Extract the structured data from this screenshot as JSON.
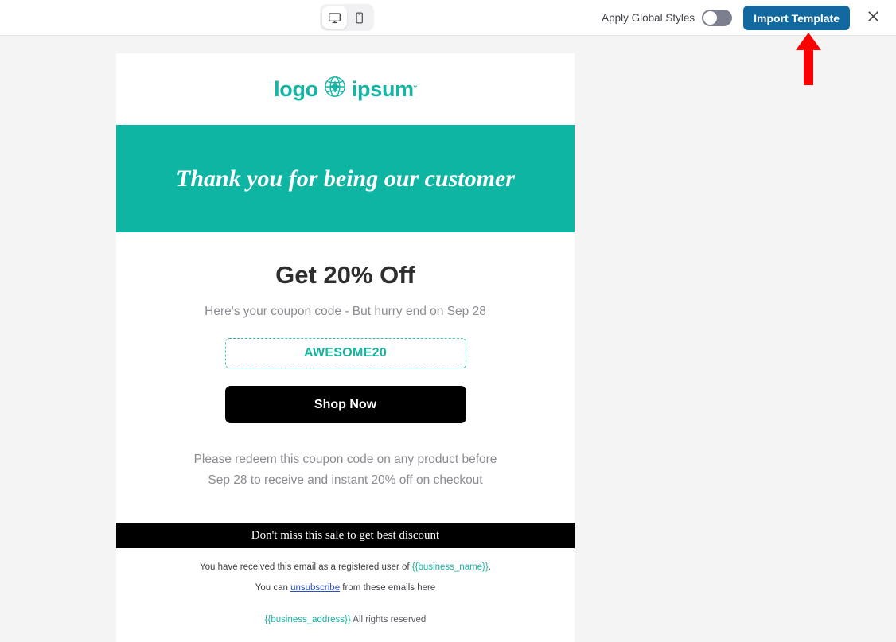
{
  "toolbar": {
    "device_switcher": {
      "options": [
        {
          "id": "desktop",
          "icon": "desktop-monitor-icon",
          "active": true
        },
        {
          "id": "mobile",
          "icon": "mobile-phone-icon",
          "active": false
        }
      ]
    },
    "apply_global_styles_label": "Apply Global Styles",
    "apply_global_styles_on": false,
    "import_template_label": "Import Template",
    "close_icon": "close-x-icon",
    "accent_blue": "#11699f"
  },
  "annotation": {
    "arrow_icon": "red-up-arrow-icon",
    "color": "#fa0000",
    "points_at": "Import Template"
  },
  "email": {
    "brand": {
      "word_one": "logo",
      "word_two": "ipsum",
      "trademark": "˘",
      "icon": "globe-compass-icon",
      "color": "#16b5a3"
    },
    "banner": {
      "text": "Thank you for being our customer",
      "background": "#0fb5a3",
      "text_color": "#ffffff"
    },
    "headline": "Get 20% Off",
    "subtitle": "Here's your coupon code - But hurry end on Sep 28",
    "coupon_code": "AWESOME20",
    "coupon_color": "#17b3a1",
    "cta_label": "Shop Now",
    "cta_background": "#000000",
    "redeem_line_1": "Please redeem this coupon code on any product before",
    "redeem_line_2": "Sep 28 to receive and instant 20% off on checkout",
    "strip_text": "Don't miss this sale to get best discount",
    "footer": {
      "line1_before": "You have received this email as a registered user of ",
      "line1_merge": "{{business_name}}",
      "line1_after": ".",
      "line2_before": "You can ",
      "line2_link": "unsubscribe",
      "line2_after": " from these emails here",
      "line3_merge": "{{business_address}}",
      "line3_rights": "All rights reserved"
    }
  }
}
